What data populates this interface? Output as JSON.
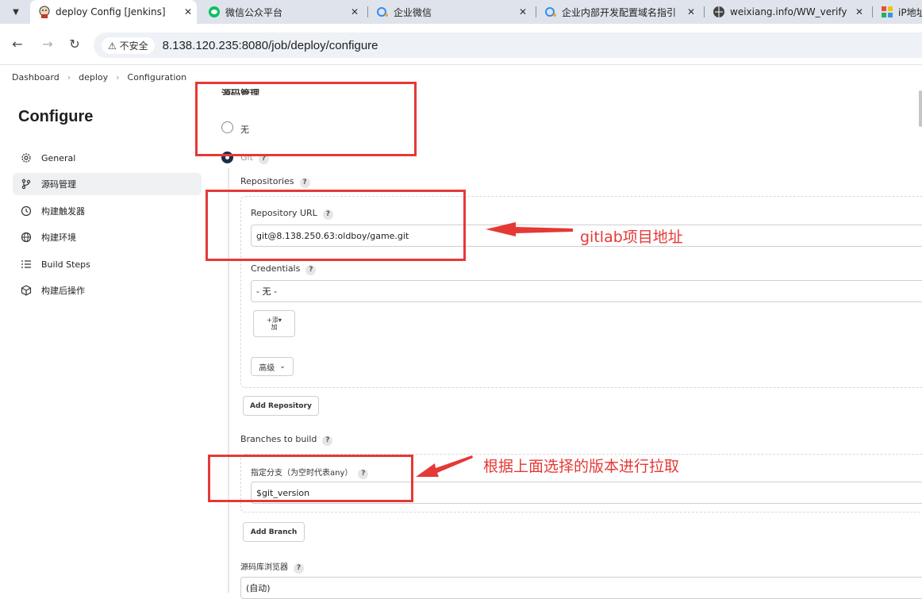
{
  "browser": {
    "tabs": [
      {
        "title": "deploy Config [Jenkins]",
        "icon": "jenkins-icon",
        "active": true
      },
      {
        "title": "微信公众平台",
        "icon": "wechat-icon",
        "active": false
      },
      {
        "title": "企业微信",
        "icon": "wecom-icon",
        "active": false
      },
      {
        "title": "企业内部开发配置域名指引",
        "icon": "wecom-icon",
        "active": false
      },
      {
        "title": "weixiang.info/WW_verify",
        "icon": "globe-icon",
        "active": false
      },
      {
        "title": "iP地址",
        "icon": "ip-icon",
        "active": false
      }
    ],
    "security_label": "不安全",
    "url": "8.138.120.235:8080/job/deploy/configure"
  },
  "breadcrumb": {
    "items": [
      "Dashboard",
      "deploy",
      "Configuration"
    ]
  },
  "sidebar": {
    "title": "Configure",
    "items": [
      {
        "label": "General",
        "icon": "gear-icon"
      },
      {
        "label": "源码管理",
        "icon": "branch-icon"
      },
      {
        "label": "构建触发器",
        "icon": "clock-icon"
      },
      {
        "label": "构建环境",
        "icon": "globe-icon"
      },
      {
        "label": "Build Steps",
        "icon": "list-icon"
      },
      {
        "label": "构建后操作",
        "icon": "cube-icon"
      }
    ]
  },
  "scm": {
    "section_title": "源码管理",
    "option_none": "无",
    "option_git": "Git",
    "repositories_label": "Repositories",
    "repo_url_label": "Repository URL",
    "repo_url_value": "git@8.138.250.63:oldboy/game.git",
    "credentials_label": "Credentials",
    "credentials_value": "- 无 -",
    "add_label_top": "添",
    "add_label_bottom": "加",
    "advanced_label": "高级",
    "add_repository": "Add Repository",
    "branches_label": "Branches to build",
    "branch_specifier_label": "指定分支（为空时代表any）",
    "branch_value": "$git_version",
    "add_branch": "Add Branch",
    "browser_label": "源码库浏览器",
    "browser_value": "(自动)",
    "help": "?"
  },
  "annotations": {
    "note_gitlab": "gitlab项目地址",
    "note_branch": "根据上面选择的版本进行拉取",
    "color": "#e53935"
  }
}
